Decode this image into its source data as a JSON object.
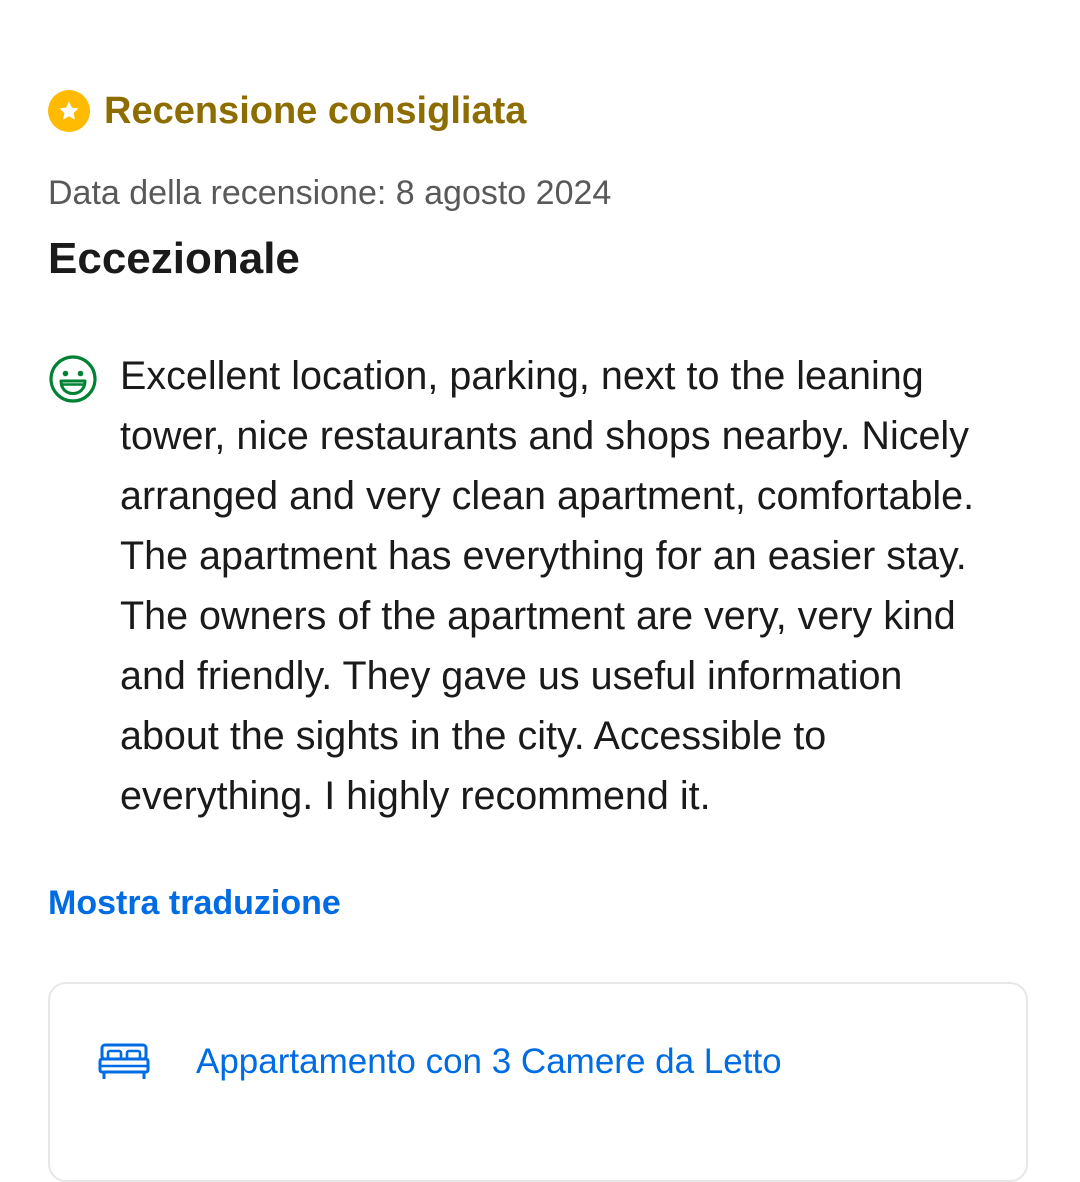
{
  "featured": {
    "label": "Recensione consigliata",
    "icon": "star-icon",
    "badge_color": "#febb02",
    "label_color": "#8d6d00"
  },
  "review": {
    "date": "Data della recensione: 8 agosto 2024",
    "title": "Eccezionale",
    "positive_icon": "smiley-icon",
    "positive_color": "#008234",
    "text_lines": [
      "Excellent location, parking, next to the leaning",
      "tower, nice restaurants and shops nearby. Nicely",
      "arranged and very clean apartment, comfortable.",
      "The apartment has everything for an easier stay.",
      "The owners of the apartment are very, very kind",
      "and friendly. They gave us useful information",
      "about the sights in the city. Accessible to",
      "everything. I highly recommend it."
    ],
    "translate_link": "Mostra traduzione"
  },
  "room": {
    "icon": "bed-icon",
    "label": "Appartamento con 3 Camere da Letto"
  },
  "colors": {
    "link": "#006ce4",
    "text": "#1a1a1a",
    "muted": "#595959",
    "card_border": "#e7e7e7"
  }
}
